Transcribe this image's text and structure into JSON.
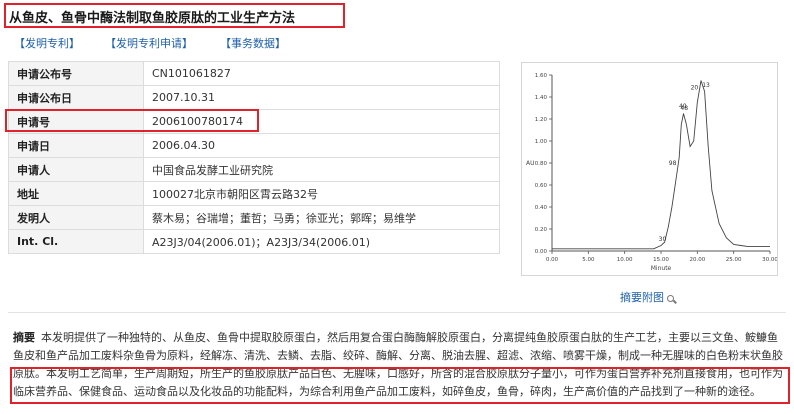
{
  "title": "从鱼皮、鱼骨中酶法制取鱼胶原肽的工业生产方法",
  "links": [
    "【发明专利】",
    "【发明专利申请】",
    "【事务数据】"
  ],
  "fields": [
    {
      "key": "申请公布号",
      "value": "CN101061827"
    },
    {
      "key": "申请公布日",
      "value": "2007.10.31"
    },
    {
      "key": "申请号",
      "value": "2006100780174"
    },
    {
      "key": "申请日",
      "value": "2006.04.30"
    },
    {
      "key": "申请人",
      "value": "中国食品发酵工业研究院"
    },
    {
      "key": "地址",
      "value": "100027北京市朝阳区霄云路32号"
    },
    {
      "key": "发明人",
      "value": "蔡木易；谷瑞增；董哲；马勇；徐亚光；郭晖；易维学"
    },
    {
      "key": "Int. Cl.",
      "value": "A23J3/04(2006.01)；A23J3/34(2006.01)"
    }
  ],
  "thumbnail_link": "摘要附图",
  "abstract_label": "摘要",
  "abstract_text": "本发明提供了一种独特的、从鱼皮、鱼骨中提取胶原蛋白，然后用复合蛋白酶酶解胶原蛋白，分离提纯鱼胶原蛋白肽的生产工艺，主要以三文鱼、鮟鱇鱼鱼皮和鱼产品加工废料杂鱼骨为原料，经解冻、清洗、去鳞、去脂、绞碎、酶解、分离、脱油去腥、超滤、浓缩、喷雾干燥，制成一种无腥味的白色粉末状鱼胶原肽。本发明工艺简单，生产周期短，所生产的鱼胶原肽产品白色、无腥味，口感好，所含的混合胶原肽分子量小，可作为蛋白营养补充剂直接食用，也可作为临床营养品、保健食品、运动食品以及化妆品的功能配料，为综合利用鱼产品加工废料，如碎鱼皮，鱼骨，碎肉，生产高价值的产品找到了一种新的途径。",
  "chart_data": {
    "type": "line",
    "ylabel": "AU",
    "xlabel": "Minute",
    "y_ticks": [
      "0.00",
      "0.20",
      "0.40",
      "0.60",
      "0.80",
      "1.00",
      "1.20",
      "1.40",
      "1.60"
    ],
    "x_ticks": [
      "0.00",
      "5.00",
      "10.00",
      "15.00",
      "20.00",
      "25.00",
      "30.00"
    ],
    "xlim": [
      0,
      30
    ],
    "ylim": [
      0,
      1.6
    ],
    "series": [
      {
        "x": [
          0,
          14,
          15,
          15.5,
          16,
          16.5,
          17,
          17.5,
          17.8,
          18.1,
          18.5,
          19,
          19.5,
          20,
          20.5,
          21,
          21.5,
          22,
          23,
          24,
          25,
          26,
          27,
          30
        ],
        "values": [
          0.02,
          0.02,
          0.05,
          0.08,
          0.22,
          0.4,
          0.62,
          0.85,
          1.15,
          1.25,
          1.15,
          0.95,
          1.0,
          1.35,
          1.55,
          1.45,
          0.95,
          0.55,
          0.25,
          0.12,
          0.06,
          0.05,
          0.04,
          0.04
        ]
      }
    ],
    "annotations": [
      {
        "text": "30",
        "x": 15.2,
        "y": 0.09
      },
      {
        "text": "98",
        "x": 16.6,
        "y": 0.78
      },
      {
        "text": "40",
        "x": 18.0,
        "y": 1.3
      },
      {
        "text": "48",
        "x": 18.2,
        "y": 1.28
      },
      {
        "text": "20",
        "x": 19.6,
        "y": 1.47
      },
      {
        "text": "13",
        "x": 21.2,
        "y": 1.49
      }
    ]
  }
}
